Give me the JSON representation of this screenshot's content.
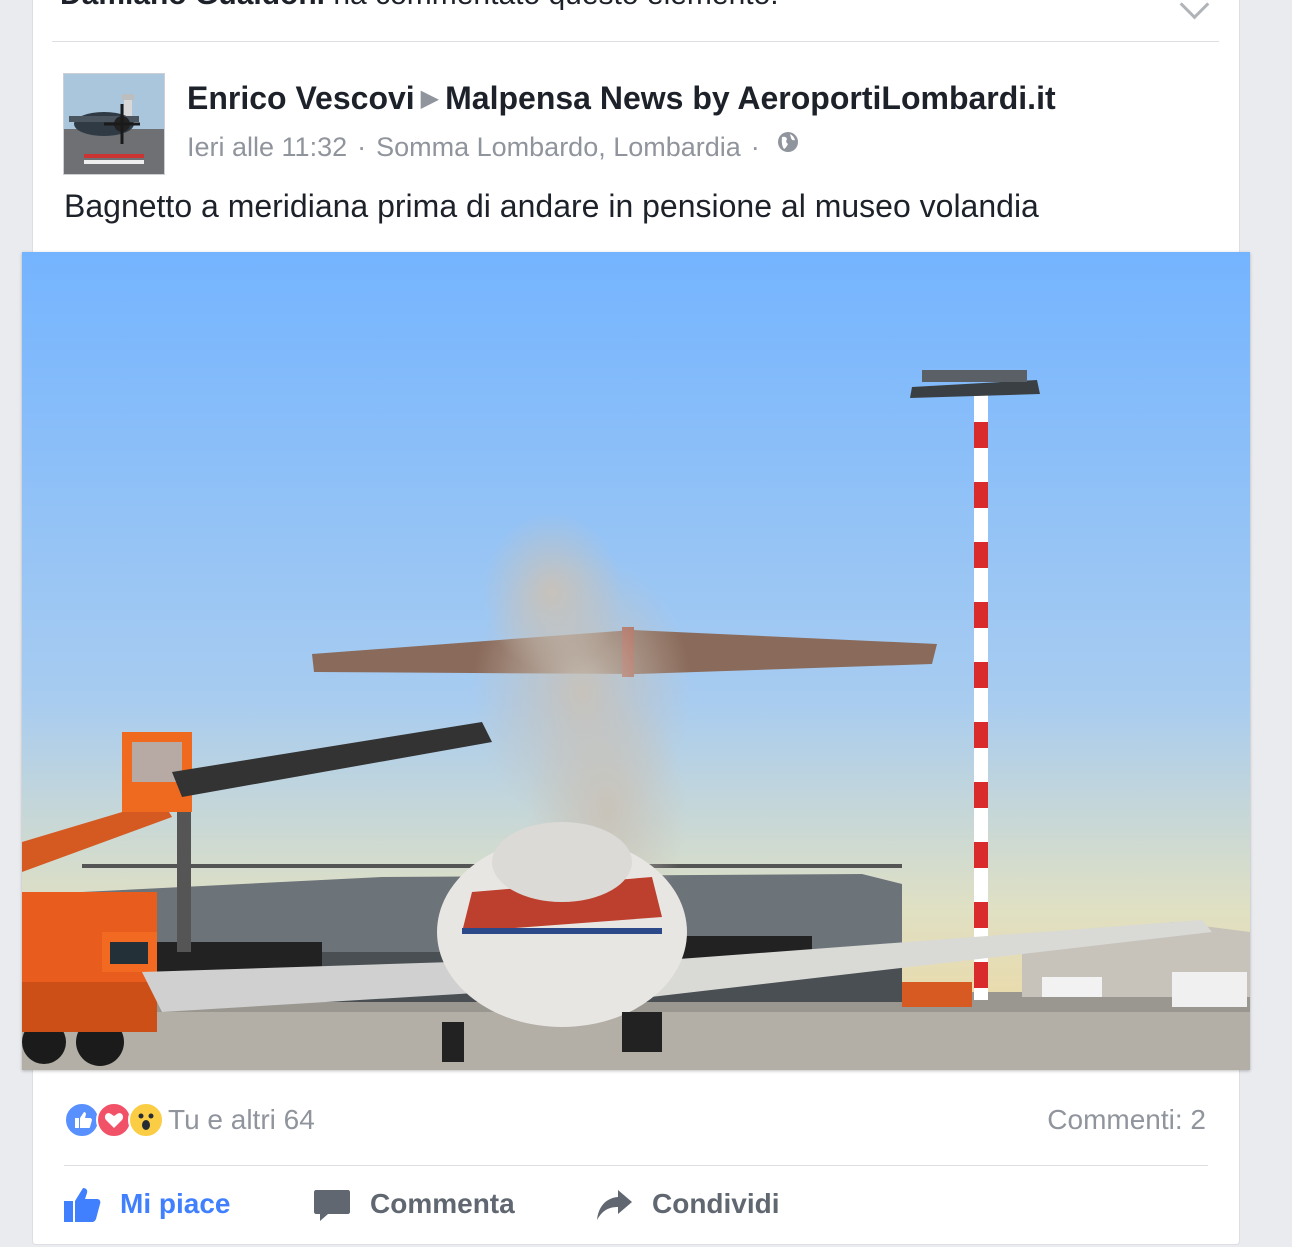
{
  "notification": {
    "actor": "Damiano Gualdoni",
    "text": "ha commentato questo elemento."
  },
  "post": {
    "author": "Enrico Vescovi",
    "target": "Malpensa News by AeroportiLombardi.it",
    "time": "Ieri alle 11:32",
    "location": "Somma Lombardo, Lombardia",
    "privacy_icon": "globe-icon",
    "text": "Bagnetto a meridiana prima di andare in pensione al museo volandia",
    "photo_subject": "airplane-de-icing-photo"
  },
  "stats": {
    "reactions": [
      "like-reaction",
      "love-reaction",
      "wow-reaction"
    ],
    "reaction_text": "Tu e altri 64",
    "comments_text": "Commenti: 2"
  },
  "actions": {
    "like": "Mi piace",
    "comment": "Commenta",
    "share": "Condividi"
  },
  "colors": {
    "accent": "#4080ff",
    "muted": "#90949c",
    "like": "#5890ff",
    "love": "#f25268",
    "wow": "#fbcd45"
  }
}
